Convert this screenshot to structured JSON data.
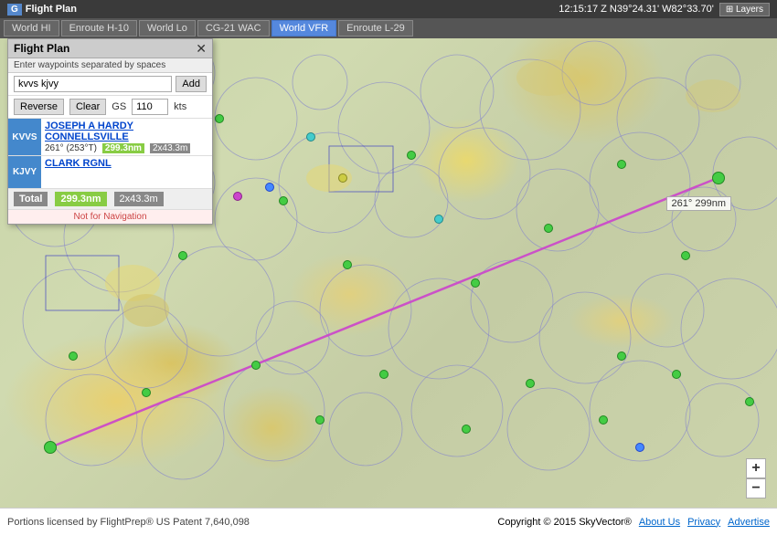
{
  "topbar": {
    "logo": "G",
    "title": "Flight Plan",
    "coords": "12:15:17 Z   N39°24.31' W82°33.70'",
    "layers_label": "⊞ Layers"
  },
  "chart_tabs": [
    {
      "id": "world-hi",
      "label": "World HI",
      "active": false
    },
    {
      "id": "enroute-h10",
      "label": "Enroute H-10",
      "active": false
    },
    {
      "id": "world-lo",
      "label": "World Lo",
      "active": false
    },
    {
      "id": "cg21-wac",
      "label": "CG-21 WAC",
      "active": false
    },
    {
      "id": "world-vfr",
      "label": "World VFR",
      "active": true
    },
    {
      "id": "enroute-l29",
      "label": "Enroute L-29",
      "active": false
    }
  ],
  "flight_plan": {
    "title": "Flight Plan",
    "subtitle": "Enter waypoints separated by spaces",
    "input_value": "kvvs kjvy",
    "add_label": "Add",
    "reverse_label": "Reverse",
    "clear_label": "Clear",
    "gs_label": "GS",
    "gs_value": "110",
    "kts_label": "kts",
    "waypoints": [
      {
        "id": "wp1",
        "badge": "KVVS",
        "name": "JOSEPH A HARDY CONNELLSVILLE",
        "bearing": "261° (253°T)",
        "distance": "299.3nm",
        "time": "2x43.3m"
      },
      {
        "id": "wp2",
        "badge": "KJVY",
        "name": "CLARK RGNL",
        "bearing": "",
        "distance": "",
        "time": ""
      }
    ],
    "total_label": "Total",
    "total_distance": "299.3nm",
    "total_time": "2x43.3m",
    "disclaimer": "Not for Navigation"
  },
  "flight_path_label": "261° 299nm",
  "footer": {
    "copyright": "Portions licensed by FlightPrep® US Patent 7,640,098",
    "copyright_year": "Copyright © 2015 SkyVector®",
    "links": [
      "About Us",
      "Privacy",
      "Advertise"
    ]
  },
  "zoom": {
    "plus": "+",
    "minus": "−"
  }
}
